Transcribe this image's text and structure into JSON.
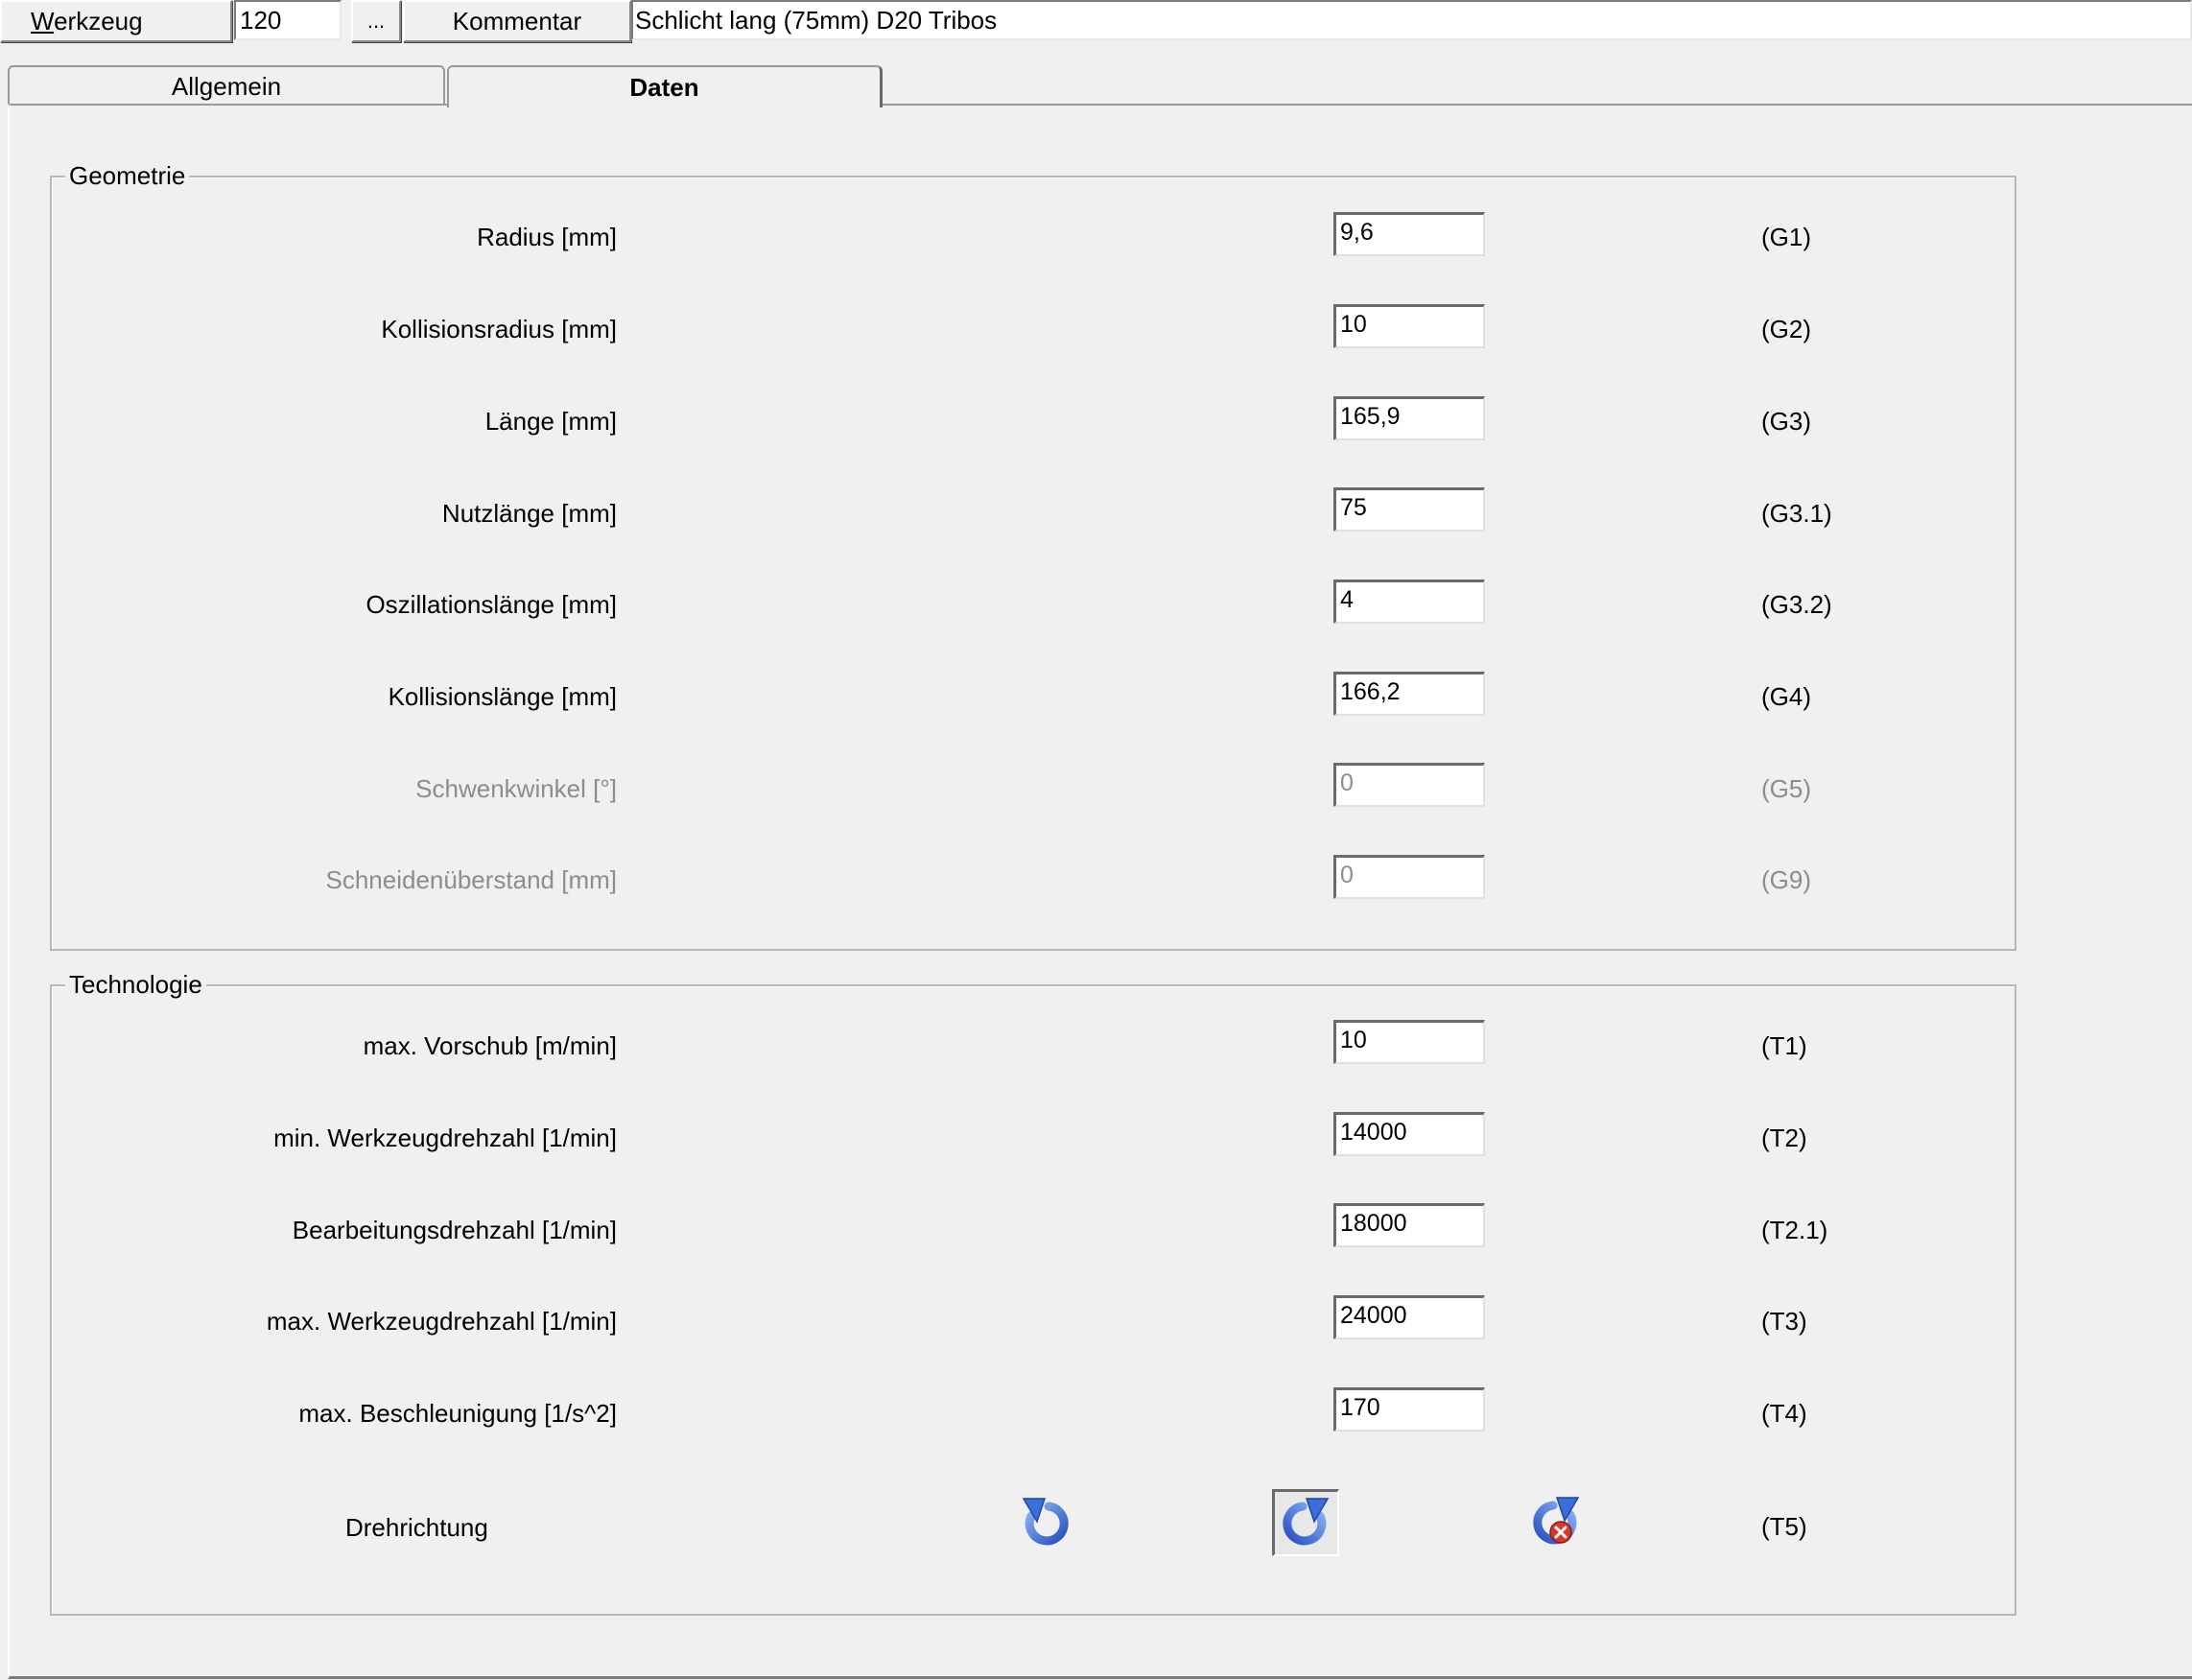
{
  "toolbar": {
    "werkzeug_label_first": "W",
    "werkzeug_label_rest": "erkzeug",
    "werkzeug_value": "120",
    "browse_label": "...",
    "kommentar_label": "Kommentar",
    "kommentar_value": "Schlicht lang (75mm) D20 Tribos"
  },
  "tabs": [
    {
      "label": "Allgemein",
      "active": false
    },
    {
      "label": "Daten",
      "active": true
    }
  ],
  "geometrie": {
    "title": "Geometrie",
    "rows": [
      {
        "label": "Radius [mm]",
        "value": "9,6",
        "code": "(G1)",
        "enabled": true
      },
      {
        "label": "Kollisionsradius [mm]",
        "value": "10",
        "code": "(G2)",
        "enabled": true
      },
      {
        "label": "Länge [mm]",
        "value": "165,9",
        "code": "(G3)",
        "enabled": true
      },
      {
        "label": "Nutzlänge [mm]",
        "value": "75",
        "code": "(G3.1)",
        "enabled": true
      },
      {
        "label": "Oszillationslänge [mm]",
        "value": "4",
        "code": "(G3.2)",
        "enabled": true
      },
      {
        "label": "Kollisionslänge [mm]",
        "value": "166,2",
        "code": "(G4)",
        "enabled": true
      },
      {
        "label": "Schwenkwinkel [°]",
        "value": "0",
        "code": "(G5)",
        "enabled": false
      },
      {
        "label": "Schneidenüberstand [mm]",
        "value": "0",
        "code": "(G9)",
        "enabled": false
      }
    ]
  },
  "technologie": {
    "title": "Technologie",
    "rows": [
      {
        "label": "max. Vorschub [m/min]",
        "value": "10",
        "code": "(T1)"
      },
      {
        "label": "min. Werkzeugdrehzahl [1/min]",
        "value": "14000",
        "code": "(T2)"
      },
      {
        "label": "Bearbeitungsdrehzahl [1/min]",
        "value": "18000",
        "code": "(T2.1)"
      },
      {
        "label": "max. Werkzeugdrehzahl [1/min]",
        "value": "24000",
        "code": "(T3)"
      },
      {
        "label": "max. Beschleunigung [1/s^2]",
        "value": "170",
        "code": "(T4)"
      }
    ],
    "drehrichtung": {
      "label": "Drehrichtung",
      "code": "(T5)",
      "buttons": [
        {
          "icon": "rotate-counterclockwise-icon",
          "selected": false
        },
        {
          "icon": "rotate-clockwise-icon",
          "selected": true
        },
        {
          "icon": "rotate-none-icon",
          "selected": false
        }
      ]
    }
  },
  "colors": {
    "icon_blue": "#3a6fd8",
    "icon_red": "#d83a2a",
    "disabled_text": "#8c8c8c"
  }
}
